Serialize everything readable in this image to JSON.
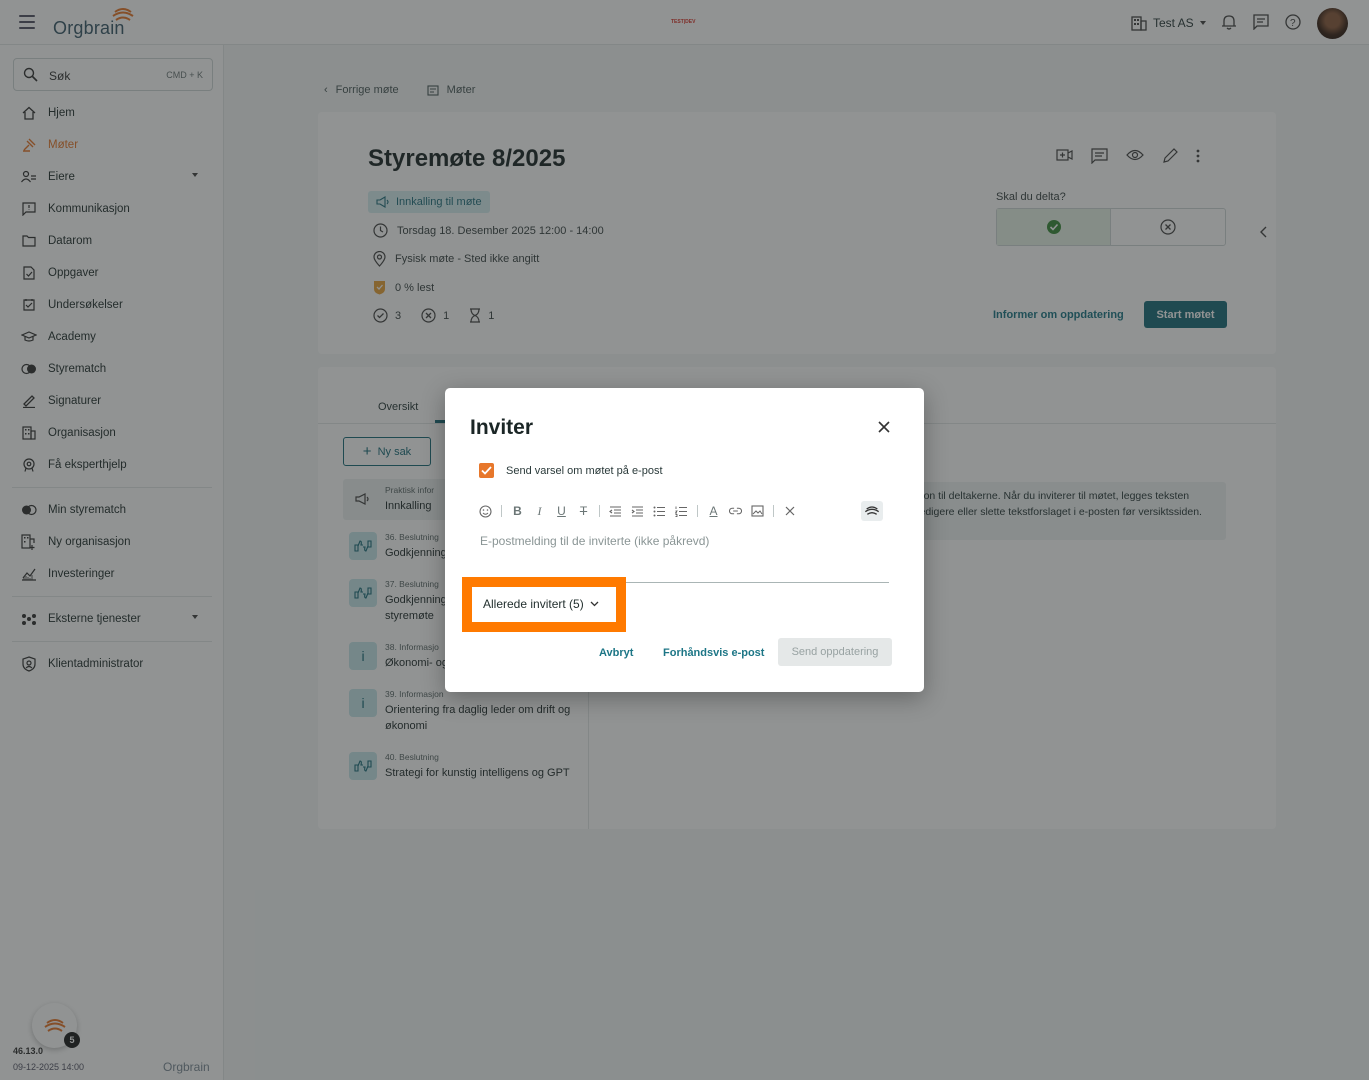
{
  "topbar": {
    "logo_text": "Orgbrain",
    "env_badge": "TEST|DEV",
    "org_name": "Test AS",
    "colors": {
      "brand_orange": "#e7772b",
      "brand_teal": "#1a6c7a"
    }
  },
  "sidebar": {
    "search_label": "Søk",
    "search_shortcut": "CMD + K",
    "items": [
      {
        "label": "Hjem",
        "icon": "home-icon"
      },
      {
        "label": "Møter",
        "icon": "gavel-icon",
        "active": true
      },
      {
        "label": "Eiere",
        "icon": "owners-icon",
        "expandable": true
      },
      {
        "label": "Kommunikasjon",
        "icon": "message-icon"
      },
      {
        "label": "Datarom",
        "icon": "folder-icon"
      },
      {
        "label": "Oppgaver",
        "icon": "task-icon"
      },
      {
        "label": "Undersøkelser",
        "icon": "survey-icon"
      },
      {
        "label": "Academy",
        "icon": "academy-icon"
      },
      {
        "label": "Styrematch",
        "icon": "match-icon"
      },
      {
        "label": "Signaturer",
        "icon": "signature-icon"
      },
      {
        "label": "Organisasjon",
        "icon": "building-icon"
      },
      {
        "label": "Få eksperthjelp",
        "icon": "expert-icon"
      }
    ],
    "items2": [
      {
        "label": "Min styrematch",
        "icon": "match-icon"
      },
      {
        "label": "Ny organisasjon",
        "icon": "building-add-icon"
      },
      {
        "label": "Investeringer",
        "icon": "chart-icon"
      }
    ],
    "items3": [
      {
        "label": "Eksterne tjenester",
        "icon": "services-icon",
        "expandable": true
      }
    ],
    "items4": [
      {
        "label": "Klientadministrator",
        "icon": "admin-icon"
      }
    ],
    "badge_count": "5",
    "version": "46.13.0",
    "version_date": "09-12-2025 14:00",
    "footer_logo": "Orgbrain"
  },
  "breadcrumb": {
    "back": "Forrige møte",
    "meetings": "Møter"
  },
  "meeting": {
    "title": "Styremøte 8/2025",
    "chip": "Innkalling til møte",
    "date": "Torsdag 18. Desember 2025 12:00 - 14:00",
    "location": "Fysisk møte - Sted ikke angitt",
    "read": "0 % lest",
    "stats": {
      "accepted": "3",
      "declined": "1",
      "pending": "1"
    },
    "attend_question": "Skal du delta?",
    "inform_link": "Informer om oppdatering",
    "start_button": "Start møtet"
  },
  "tabs": {
    "overview": "Oversikt"
  },
  "new_item_button": "Ny sak",
  "agenda": [
    {
      "category": "Praktisk infor",
      "name": "Innkalling",
      "icon": "megaphone-icon",
      "selected": true
    },
    {
      "category": "36. Beslutning",
      "name": "Godkjenning",
      "icon": "vote-icon"
    },
    {
      "category": "37. Beslutning",
      "name": "Godkjenning\nstyremøte",
      "icon": "vote-icon"
    },
    {
      "category": "38. Informasjo",
      "name": "Økonomi- og",
      "icon": "info-icon"
    },
    {
      "category": "39. Informasjon",
      "name": "Orientering fra daglig leder om drift og økonomi",
      "icon": "info-icon"
    },
    {
      "category": "40. Beslutning",
      "name": "Strategi for kunstig intelligens og GPT",
      "icon": "vote-icon"
    }
  ],
  "info_banner": "sjon til deltakerne. Når du inviterer til møtet, legges teksten redigere eller slette tekstforslaget i e-posten før versiktssiden.",
  "modal": {
    "title": "Inviter",
    "checkbox_label": "Send varsel om møtet på e-post",
    "checked": true,
    "editor_placeholder": "E-postmelding til de inviterte (ikke påkrevd)",
    "invited_dropdown": "Allerede invitert (5)",
    "cancel": "Avbryt",
    "preview": "Forhåndsvis e-post",
    "send": "Send oppdatering"
  }
}
